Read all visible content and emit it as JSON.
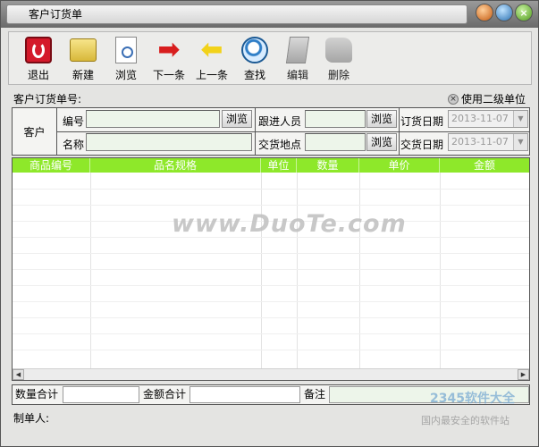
{
  "window": {
    "title": "客户订货单",
    "buttons": [
      "minimize",
      "maximize",
      "close"
    ]
  },
  "toolbar": {
    "exit": "退出",
    "new": "新建",
    "browse": "浏览",
    "next": "下一条",
    "prev": "上一条",
    "find": "查找",
    "edit": "编辑",
    "delete": "删除"
  },
  "form": {
    "order_no_label": "客户订货单号:",
    "second_unit_label": "使用二级单位",
    "customer_label": "客户",
    "code_label": "编号",
    "code_value": "",
    "name_label": "名称",
    "name_value": "",
    "browse_label": "浏览",
    "follow_label": "跟进人员",
    "follow_value": "",
    "delivery_place_label": "交货地点",
    "delivery_place_value": "",
    "order_date_label": "订货日期",
    "order_date_value": "2013-11-07",
    "delivery_date_label": "交货日期",
    "delivery_date_value": "2013-11-07"
  },
  "grid": {
    "columns": [
      "商品编号",
      "品名规格",
      "单位",
      "数量",
      "单价",
      "金额"
    ],
    "rows": []
  },
  "totals": {
    "qty_label": "数量合计",
    "qty_value": "",
    "amount_label": "金额合计",
    "amount_value": "",
    "remark_label": "备注",
    "remark_value": ""
  },
  "footer": {
    "creator_label": "制单人:"
  },
  "watermarks": {
    "center": "www.DuoTe.com",
    "corner_brand": "2345软件大全",
    "corner_slogan": "国内最安全的软件站"
  },
  "colors": {
    "grid_header": "#8ee82a",
    "input_bg": "#edf5ea",
    "exit_icon": "#d4192a"
  }
}
